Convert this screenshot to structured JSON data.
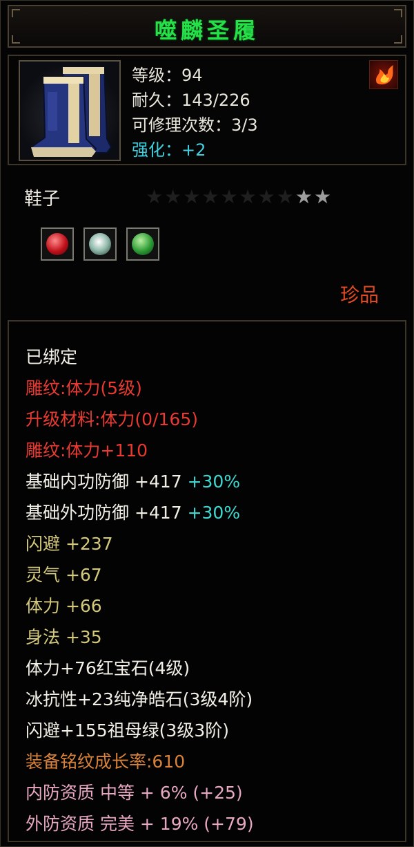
{
  "title": "噬麟圣履",
  "stats": {
    "level": "等级：94",
    "durability": "耐久：143/226",
    "repair": "可修理次数：3/3",
    "enhance": "强化：+2"
  },
  "type_label": "鞋子",
  "stars": {
    "total": 10,
    "lit": 2
  },
  "gems": [
    {
      "icon": "ruby-gem-icon",
      "color": "#d8202a"
    },
    {
      "icon": "diamond-gem-icon",
      "color": "#c8e0d8"
    },
    {
      "icon": "emerald-gem-icon",
      "color": "#3aa840"
    }
  ],
  "quality": "珍品",
  "properties": {
    "bound": "已绑定",
    "engrave": "雕纹:体力(5级)",
    "upgrade_material": "升级材料:体力(0/165)",
    "engrave_bonus": "雕纹:体力+110",
    "inner_def": {
      "label": "基础内功防御 +417",
      "bonus": "+30%"
    },
    "outer_def": {
      "label": "基础外功防御 +417",
      "bonus": "+30%"
    },
    "dodge": "闪避 +237",
    "spirit": "灵气 +67",
    "stamina": "体力 +66",
    "agility": "身法 +35",
    "gem1": "体力+76红宝石(4级)",
    "gem2": "冰抗性+23纯净皓石(3级4阶)",
    "gem3": "闪避+155祖母绿(3级3阶)",
    "growth": "装备铭纹成长率:610",
    "inner_quality": "内防资质 中等 + 6% (+25)",
    "outer_quality": "外防资质 完美 + 19% (+79)"
  },
  "colors": {
    "title": "#26e04a",
    "white": "#f2efe6",
    "red": "#e83a32",
    "yellow": "#d4c97a",
    "orange": "#d8823a",
    "pink": "#e9a8c2",
    "cyan": "#3ed8d0"
  }
}
